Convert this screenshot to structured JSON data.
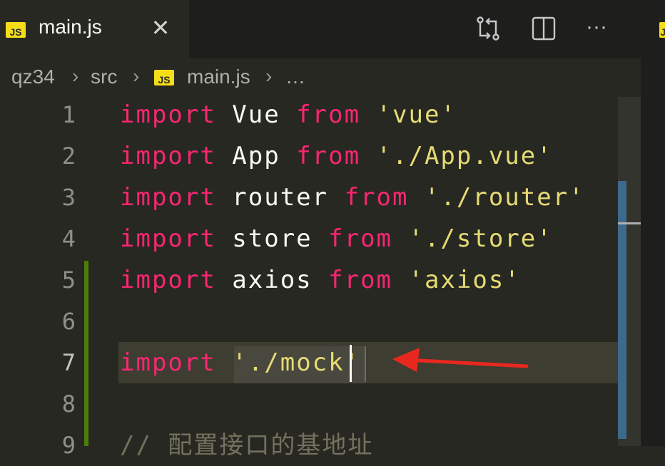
{
  "tab": {
    "icon": "JS",
    "title": "main.js",
    "close": "✕"
  },
  "actions": {
    "compare_icon": "git-compare-icon",
    "split_icon": "split-editor-icon",
    "more_label": "···"
  },
  "side_tab_icon": "JS",
  "breadcrumb": {
    "items": [
      "qz34",
      "src",
      "main.js",
      "…"
    ],
    "separator": "›",
    "file_icon": "JS"
  },
  "editor": {
    "lines": [
      {
        "n": "1",
        "t1": "import",
        "t2": " Vue ",
        "t3": "from",
        "t4": " 'vue'"
      },
      {
        "n": "2",
        "t1": "import",
        "t2": " App ",
        "t3": "from",
        "t4": " './App.vue'"
      },
      {
        "n": "3",
        "t1": "import",
        "t2": " router ",
        "t3": "from",
        "t4": " './router'"
      },
      {
        "n": "4",
        "t1": "import",
        "t2": " store ",
        "t3": "from",
        "t4": " './store'"
      },
      {
        "n": "5",
        "t1": "import",
        "t2": " axios ",
        "t3": "from",
        "t4": " 'axios'"
      },
      {
        "n": "6",
        "t1": "",
        "t2": "",
        "t3": "",
        "t4": ""
      },
      {
        "n": "7",
        "t1": "import",
        "t2": " ",
        "t3": "",
        "t4": "'./mock'"
      },
      {
        "n": "8",
        "t1": "",
        "t2": "",
        "t3": "",
        "t4": ""
      },
      {
        "n": "9",
        "comment": "// 配置接口的基地址"
      }
    ]
  },
  "colors": {
    "background": "#272822",
    "keyword": "#f92672",
    "string": "#e6db74",
    "arrow": "#e8281e"
  }
}
